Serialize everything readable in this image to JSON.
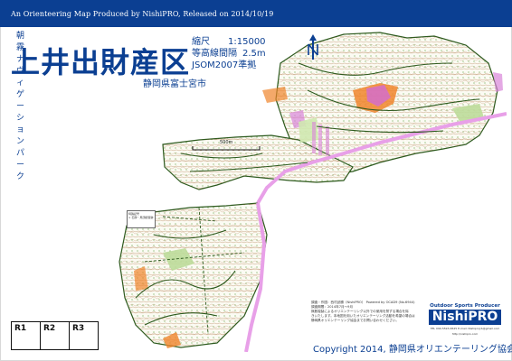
{
  "header": {
    "banner": "An Orienteering Map Produced by NishiPRO, Released on 2014/10/19"
  },
  "title": {
    "subtitle": "朝霧ナヴィゲーションパーク",
    "main": "上井出財産区",
    "location": "静岡県富士宮市"
  },
  "specs": [
    {
      "label": "縮尺",
      "value": "1:15000"
    },
    {
      "label": "等高線間隔",
      "value": "2.5m"
    },
    {
      "label": "JSOM2007準拠",
      "value": ""
    }
  ],
  "scale_label": "500m",
  "legend": {
    "title": "特殊記号",
    "item": "× 石碑・馬頭観音跡"
  },
  "grid_boxes": [
    "R1",
    "R2",
    "R3"
  ],
  "credits": [
    "調査・作図：西村武勝（NishiPRO）  Powered by OCAD9 (No.6944)",
    "調査期間：2014年7月～9月",
    "無断複製によるオリエンテーリング以外での使用を禁ずる場合を除",
    "きいたします。本地図を用いたオリエンテーリング活動を希望の場合は",
    "静岡県オリエンテーリング協会までお問い合わせください。"
  ],
  "brand": {
    "tagline": "Outdoor Sports Producer",
    "logo": "NishiPRO",
    "contact": "TEL 090-5593-6525   E-mail: NishiproJ-S@gmail.com",
    "url": "http://nishipro.com"
  },
  "copyright": "Copyright 2014, 静岡県オリエンテーリング協会",
  "colors": {
    "banner": "#0b3f92",
    "open_land": "#f5a623",
    "road": "#e8a0e8",
    "boundary": "#2d5a1e",
    "vegetation": "#c8e0a8"
  }
}
